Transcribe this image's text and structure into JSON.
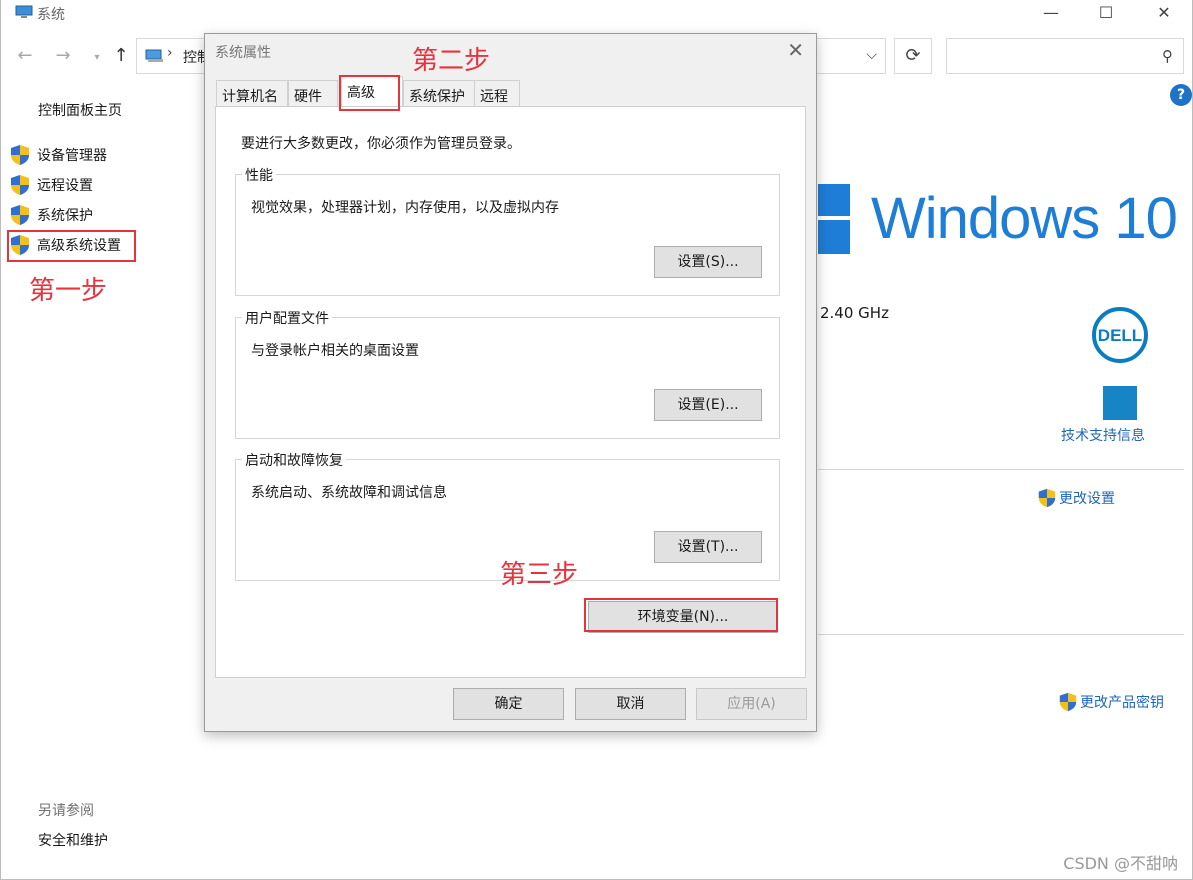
{
  "window": {
    "title": "系统",
    "min_icon": "—",
    "max_icon": "☐",
    "close_icon": "✕"
  },
  "nav": {
    "back": "←",
    "forward": "→",
    "dropdown": "▾",
    "up": "↑",
    "separator": "›",
    "breadcrumb": "控制",
    "addr_dropdown": "⌵",
    "refresh": "⟳",
    "search_icon": "⚲"
  },
  "help": "?",
  "sidebar": {
    "home": "控制面板主页",
    "items": [
      {
        "label": "设备管理器"
      },
      {
        "label": "远程设置"
      },
      {
        "label": "系统保护"
      },
      {
        "label": "高级系统设置"
      }
    ],
    "see_also": "另请参阅",
    "security": "安全和维护"
  },
  "annotations": {
    "step1": "第一步",
    "step2": "第二步",
    "step3": "第三步",
    "highlight_color": "#e8323c"
  },
  "main": {
    "windows_text": "Windows 10",
    "cpu_speed": "2.40 GHz",
    "support_link": "技术支持信息",
    "change_settings": "更改设置",
    "change_product_key": "更改产品密钥",
    "accent": "#1e7dd6"
  },
  "dialog": {
    "title": "系统属性",
    "close": "✕",
    "tabs": [
      "计算机名",
      "硬件",
      "高级",
      "系统保护",
      "远程"
    ],
    "active_tab": "高级",
    "admin_note": "要进行大多数更改，你必须作为管理员登录。",
    "groups": [
      {
        "label": "性能",
        "desc": "视觉效果，处理器计划，内存使用，以及虚拟内存",
        "button": "设置(S)..."
      },
      {
        "label": "用户配置文件",
        "desc": "与登录帐户相关的桌面设置",
        "button": "设置(E)..."
      },
      {
        "label": "启动和故障恢复",
        "desc": "系统启动、系统故障和调试信息",
        "button": "设置(T)..."
      }
    ],
    "env_button": "环境变量(N)...",
    "ok": "确定",
    "cancel": "取消",
    "apply": "应用(A)"
  },
  "watermark": "CSDN @不甜呐"
}
